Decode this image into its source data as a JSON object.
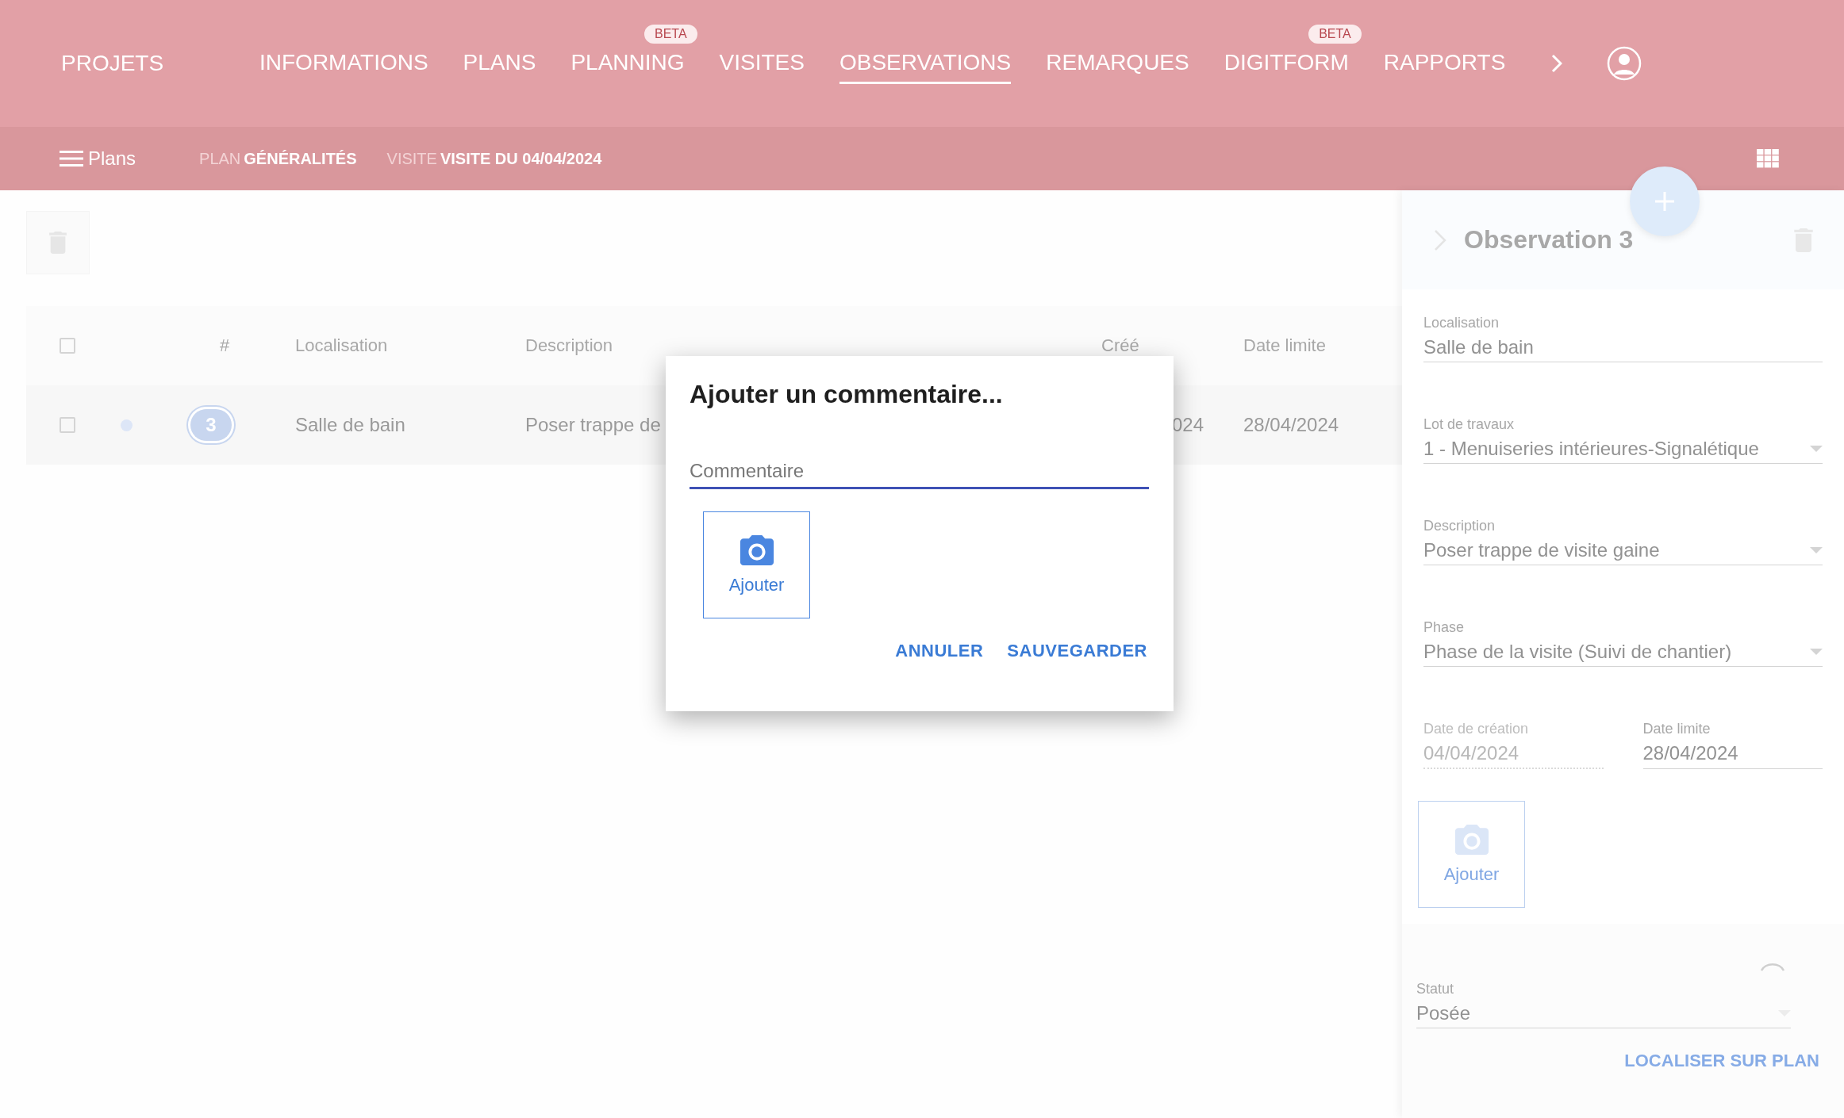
{
  "app_bar": {
    "brand": "PROJETS",
    "tabs": [
      {
        "label": "INFORMATIONS",
        "selected": false
      },
      {
        "label": "PLANS",
        "selected": false
      },
      {
        "label": "PLANNING",
        "selected": false,
        "badge": "BETA"
      },
      {
        "label": "VISITES",
        "selected": false
      },
      {
        "label": "OBSERVATIONS",
        "selected": true
      },
      {
        "label": "REMARQUES",
        "selected": false
      },
      {
        "label": "DIGITFORM",
        "selected": false,
        "badge": "BETA"
      },
      {
        "label": "RAPPORTS",
        "selected": false
      }
    ]
  },
  "sub_bar": {
    "menu_label": "Plans",
    "breadcrumbs": [
      {
        "prefix": "PLAN",
        "value": "GÉNÉRALITÉS"
      },
      {
        "prefix": "VISITE",
        "value": "VISITE DU 04/04/2024"
      }
    ]
  },
  "table": {
    "all_checked": false,
    "columns": [
      "#",
      "Localisation",
      "Description",
      "Créé",
      "Date limite"
    ],
    "rows": [
      {
        "checked": false,
        "number": "3",
        "localisation": "Salle de bain",
        "description": "Poser trappe de",
        "created": "024",
        "due": "28/04/2024"
      }
    ]
  },
  "detail_panel": {
    "title": "Observation 3",
    "fields": [
      {
        "kind": "text",
        "label": "Localisation",
        "value": "Salle de bain",
        "disabled": false
      },
      {
        "kind": "select",
        "label": "Lot de travaux",
        "value": "1 - Menuiseries intérieures-Signalétique",
        "disabled": false
      },
      {
        "kind": "select",
        "label": "Description",
        "value": "Poser trappe de visite gaine",
        "disabled": false
      },
      {
        "kind": "select",
        "label": "Phase",
        "value": "Phase de la visite (Suivi de chantier)",
        "disabled": false
      },
      {
        "kind": "pair",
        "items": [
          {
            "label": "Date de création",
            "value": "04/04/2024",
            "disabled": true
          },
          {
            "label": "Date limite",
            "value": "28/04/2024",
            "disabled": false
          }
        ]
      }
    ],
    "photo_button": "Ajouter",
    "status": {
      "label": "Statut",
      "value": "Posée"
    },
    "locate_button": "LOCALISER SUR PLAN"
  },
  "dialog": {
    "title": "Ajouter un commentaire...",
    "comment": {
      "placeholder": "Commentaire"
    },
    "photo_button": "Ajouter",
    "actions": [
      "ANNULER",
      "SAUVEGARDER"
    ]
  }
}
